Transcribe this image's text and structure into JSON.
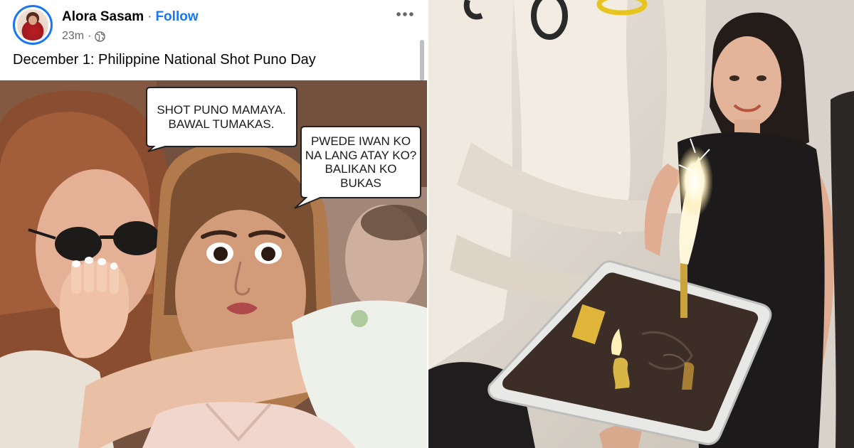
{
  "post": {
    "author": "Alora Sasam",
    "separator": "·",
    "follow_label": "Follow",
    "time": "23m",
    "meta_separator": "·",
    "audience_icon": "globe-icon",
    "more_icon": "more-options-icon",
    "caption": "December 1: Philippine National Shot Puno Day"
  },
  "meme": {
    "bubble_1": {
      "line_1": "SHOT PUNO MAMAYA.",
      "line_2": "BAWAL TUMAKAS."
    },
    "bubble_2": {
      "line_1": "PWEDE IWAN KO",
      "line_2": "NA LANG ATAY KO?",
      "line_3": "BALIKAN KO",
      "line_4": "BUKAS"
    }
  },
  "colors": {
    "link_blue": "#1877f2",
    "text_primary": "#050505",
    "text_secondary": "#65676b"
  }
}
